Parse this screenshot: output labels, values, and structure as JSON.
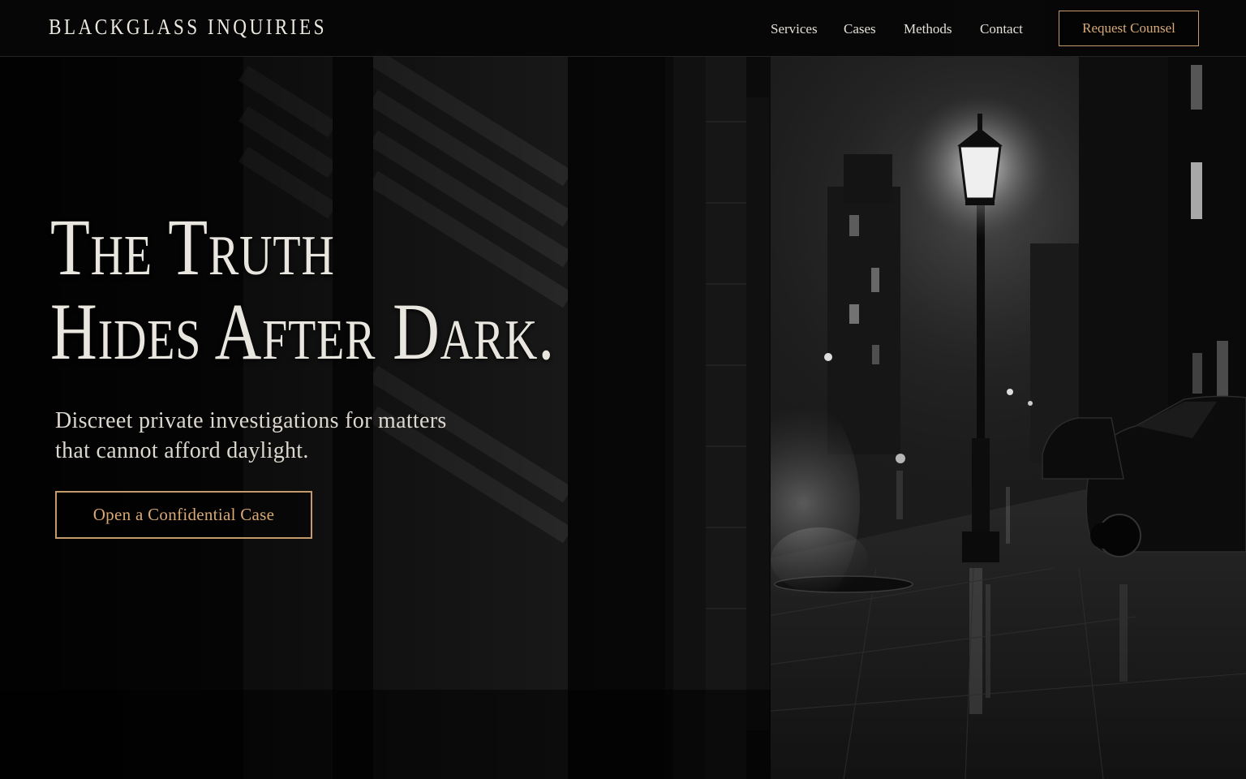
{
  "brand": {
    "name": "BLACKGLASS INQUIRIES"
  },
  "nav": {
    "links": [
      {
        "label": "Services"
      },
      {
        "label": "Cases"
      },
      {
        "label": "Methods"
      },
      {
        "label": "Contact"
      }
    ],
    "cta_label": "Request Counsel"
  },
  "hero": {
    "title_line1": "The Truth",
    "title_line2": "Hides After Dark.",
    "subtitle_line1": "Discreet private investigations for matters",
    "subtitle_line2": "that cannot afford daylight.",
    "cta_label": "Open a Confidential Case"
  },
  "colors": {
    "accent": "#c49a6c",
    "background": "#050505",
    "text": "#e9e6df"
  }
}
